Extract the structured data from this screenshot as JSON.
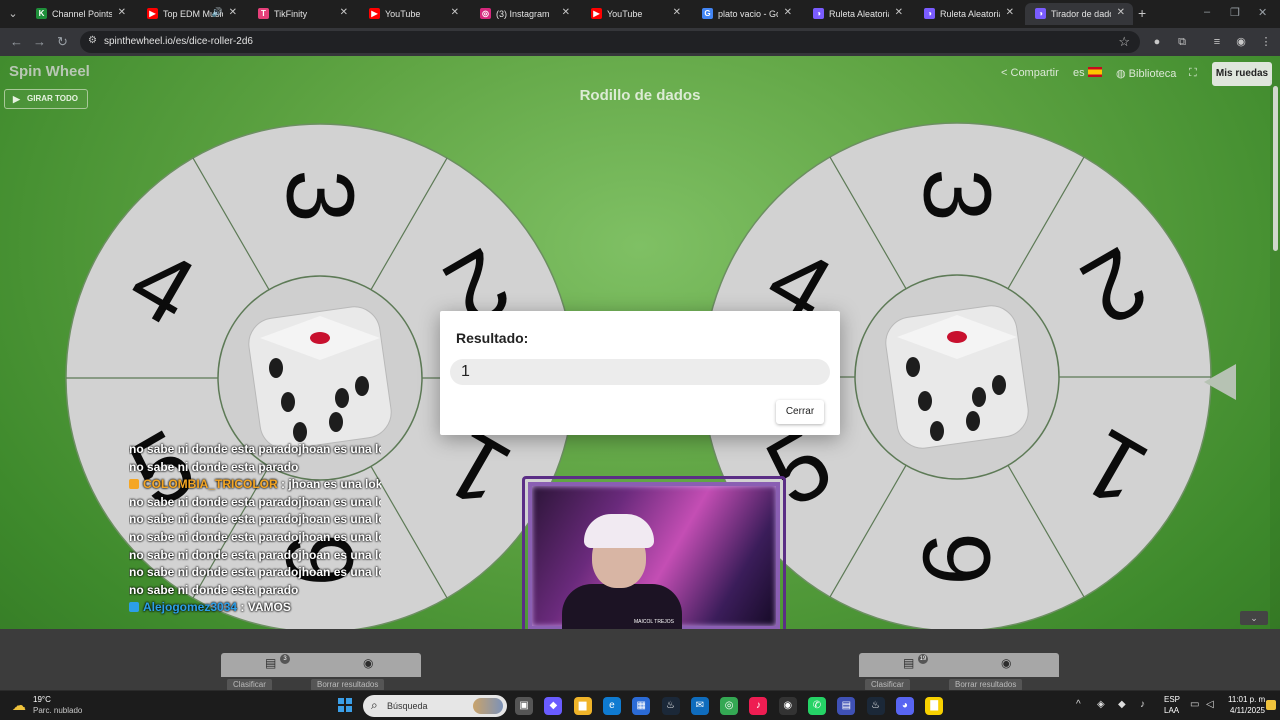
{
  "browser": {
    "tabs": [
      {
        "label": "Channel Points - K",
        "fav_color": "#1f8f3a",
        "fav_glyph": "K",
        "audio": false,
        "active": false
      },
      {
        "label": "Top EDM Music",
        "fav_color": "#ff0000",
        "fav_glyph": "▶",
        "audio": true,
        "active": false
      },
      {
        "label": "TikFinity",
        "fav_color": "#e6407a",
        "fav_glyph": "T",
        "audio": false,
        "active": false
      },
      {
        "label": "YouTube",
        "fav_color": "#ff0000",
        "fav_glyph": "▶",
        "audio": false,
        "active": false
      },
      {
        "label": "(3) Instagram",
        "fav_color": "#d6287d",
        "fav_glyph": "◎",
        "audio": false,
        "active": false
      },
      {
        "label": "YouTube",
        "fav_color": "#ff0000",
        "fav_glyph": "▶",
        "audio": false,
        "active": false
      },
      {
        "label": "plato vacio - Goog",
        "fav_color": "#4285f4",
        "fav_glyph": "G",
        "audio": false,
        "active": false
      },
      {
        "label": "Ruleta Aleatoria",
        "fav_color": "#7a5cff",
        "fav_glyph": "◑",
        "audio": false,
        "active": false
      },
      {
        "label": "Ruleta Aleatoria -",
        "fav_color": "#7a5cff",
        "fav_glyph": "◑",
        "audio": false,
        "active": false
      },
      {
        "label": "Tirador de dados",
        "fav_color": "#7a5cff",
        "fav_glyph": "◑",
        "audio": false,
        "active": true
      }
    ],
    "url": "spinthewheel.io/es/dice-roller-2d6"
  },
  "page": {
    "logo": "Spin Wheel",
    "spin_all": "GIRAR TODO",
    "title": "Rodillo de dados",
    "share": "Compartir",
    "lang": "es",
    "library": "Biblioteca",
    "my_wheels": "Mis ruedas"
  },
  "wheels": {
    "left": {
      "segments": [
        "3",
        "2",
        "1",
        "6",
        "5",
        "4"
      ],
      "rotation": -30
    },
    "right": {
      "segments": [
        "2",
        "1",
        "6",
        "5",
        "4",
        "3"
      ],
      "rotation": 30
    }
  },
  "dialog": {
    "title": "Resultado:",
    "value": "1",
    "close": "Cerrar"
  },
  "chat": [
    {
      "user": "",
      "msg": "no sabe ni donde esta paradojhoan es una loka"
    },
    {
      "user": "",
      "msg": "no sabe ni donde esta parado"
    },
    {
      "user": "COLOMBIA_TRICOLOR",
      "msg": ": jhoan es una loka",
      "color": "#f5a623"
    },
    {
      "user": "",
      "msg": "no sabe ni donde esta paradojhoan es una loka"
    },
    {
      "user": "",
      "msg": "no sabe ni donde esta paradojhoan es una loka"
    },
    {
      "user": "",
      "msg": "no sabe ni donde esta paradojhoan es una loka"
    },
    {
      "user": "",
      "msg": "no sabe ni donde esta paradojhoan es una loka"
    },
    {
      "user": "",
      "msg": "no sabe ni donde esta paradojhoan es una loka"
    },
    {
      "user": "",
      "msg": "no sabe ni donde esta parado"
    },
    {
      "user": "Alejogomez3034",
      "msg": ": VAMOS",
      "color": "#2c9fe8"
    }
  ],
  "cam": {
    "caption": "MAICOL TREJOS"
  },
  "panels": {
    "left": {
      "count": "3",
      "sort": "Clasificar",
      "clear": "Borrar resultados"
    },
    "right": {
      "count": "19",
      "sort": "Clasificar",
      "clear": "Borrar resultados"
    }
  },
  "taskbar": {
    "temp": "19°C",
    "weather": "Parc. nublado",
    "search": "Búsqueda",
    "lang1": "ESP",
    "lang2": "LAA",
    "time": "11:01 p. m.",
    "date": "4/11/2025"
  }
}
